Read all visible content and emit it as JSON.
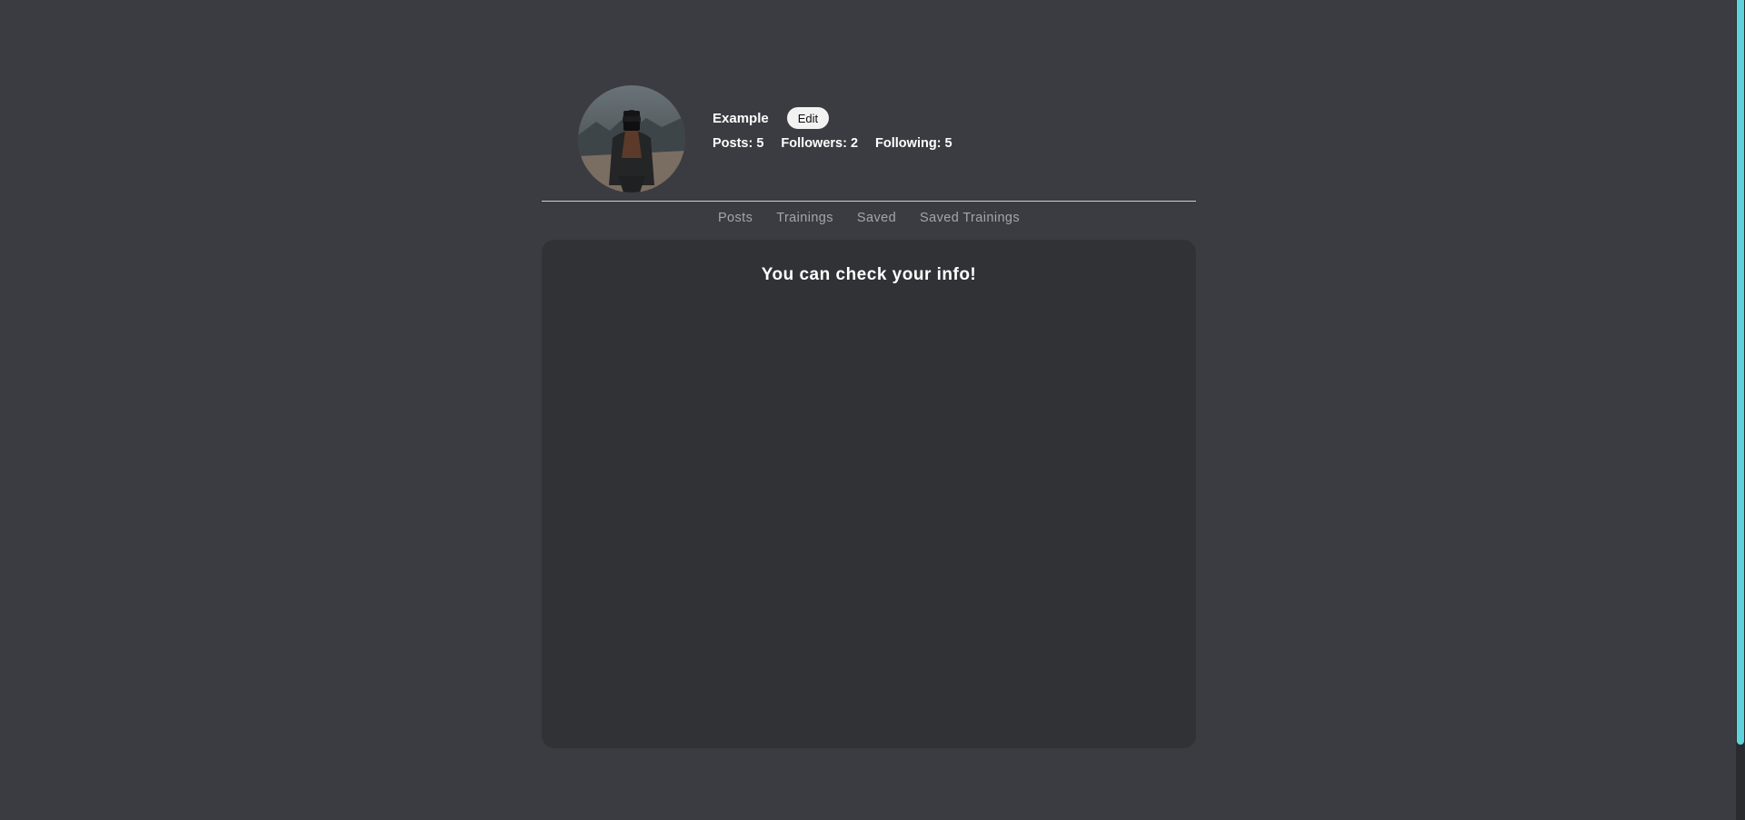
{
  "profile": {
    "username": "Example",
    "edit_label": "Edit",
    "stats": {
      "posts": "Posts: 5",
      "followers": "Followers: 2",
      "following": "Following: 5"
    }
  },
  "tabs": [
    {
      "label": "Posts"
    },
    {
      "label": "Trainings"
    },
    {
      "label": "Saved"
    },
    {
      "label": "Saved Trainings"
    }
  ],
  "panel": {
    "heading": "You can check your info!"
  },
  "colors": {
    "background": "#3b3c41",
    "panel": "#313236",
    "scrollbar_thumb": "#5fd3dc",
    "tab_text": "#a4a5aa"
  }
}
